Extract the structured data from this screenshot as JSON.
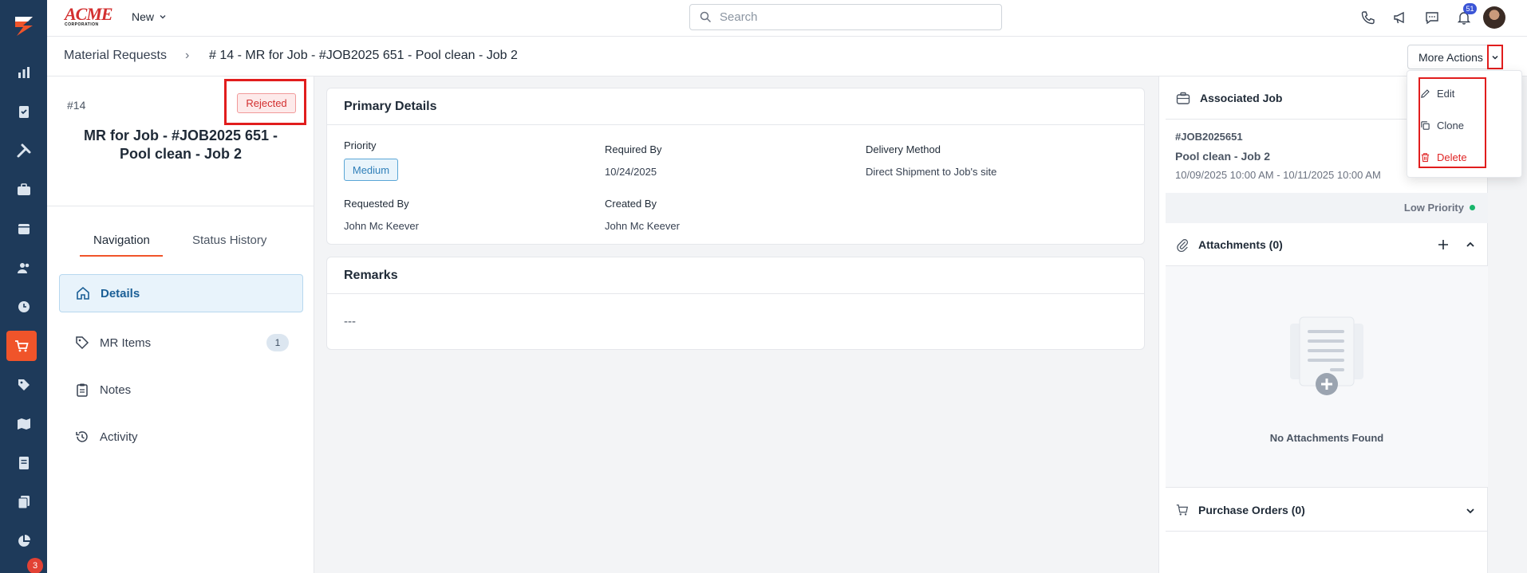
{
  "header": {
    "brand_top": "ACME",
    "brand_bottom": "CORPORATION",
    "new_label": "New",
    "search_placeholder": "Search",
    "notification_count": "51",
    "rail_badge_count": "3"
  },
  "breadcrumb": {
    "root": "Material Requests",
    "separator": "›",
    "current": "# 14 - MR for Job - #JOB2025 651 - Pool clean - Job 2"
  },
  "actions": {
    "more_actions_label": "More Actions",
    "menu": [
      {
        "label": "Edit",
        "icon": "pencil-icon"
      },
      {
        "label": "Clone",
        "icon": "copy-icon"
      },
      {
        "label": "Delete",
        "icon": "trash-icon"
      }
    ]
  },
  "request": {
    "number": "#14",
    "status": "Rejected",
    "title": "MR for Job - #JOB2025 651 - Pool clean - Job 2"
  },
  "tabs": {
    "navigation": "Navigation",
    "status_history": "Status History"
  },
  "nav": [
    {
      "label": "Details",
      "icon": "home-icon",
      "active": true
    },
    {
      "label": "MR Items",
      "icon": "tag-icon",
      "count": "1"
    },
    {
      "label": "Notes",
      "icon": "clipboard-icon"
    },
    {
      "label": "Activity",
      "icon": "history-icon"
    }
  ],
  "primary_details": {
    "heading": "Primary Details",
    "priority_label": "Priority",
    "priority_value": "Medium",
    "required_by_label": "Required By",
    "required_by_value": "10/24/2025",
    "delivery_label": "Delivery Method",
    "delivery_value": "Direct Shipment to Job's site",
    "requested_by_label": "Requested By",
    "requested_by_value": "John Mc Keever",
    "created_by_label": "Created By",
    "created_by_value": "John Mc Keever"
  },
  "remarks": {
    "heading": "Remarks",
    "value": "---"
  },
  "associated_job": {
    "heading": "Associated Job",
    "job_id": "#JOB2025651",
    "job_name": "Pool clean - Job 2",
    "dates": "10/09/2025 10:00 AM - 10/11/2025 10:00 AM",
    "priority": "Low Priority"
  },
  "attachments": {
    "heading": "Attachments (0)",
    "empty_text": "No Attachments Found"
  },
  "purchase_orders": {
    "heading": "Purchase Orders (0)"
  },
  "colors": {
    "rail": "#1e3a5a",
    "accent": "#f0542a",
    "danger": "#e02424",
    "info": "#2f7fb9"
  }
}
